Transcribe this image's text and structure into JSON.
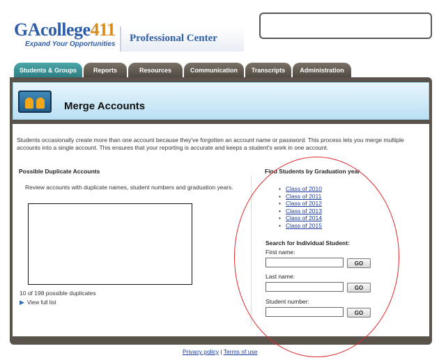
{
  "header": {
    "logo_ga": "GAcollege",
    "logo_411": "411",
    "tagline": "Expand Your Opportunities",
    "professional_center": "Professional Center"
  },
  "tabs": [
    {
      "label": "Students & Groups",
      "active": true
    },
    {
      "label": "Reports",
      "active": false
    },
    {
      "label": "Resources",
      "active": false
    },
    {
      "label": "Communication",
      "active": false
    },
    {
      "label": "Transcripts",
      "active": false
    },
    {
      "label": "Administration",
      "active": false
    }
  ],
  "page": {
    "title": "Merge Accounts",
    "intro": "Students occasionally create more than one account because they've forgotten an account name or password. This process lets you merge multiple accounts into a single account. This ensures that your reporting is accurate and keeps a student's work in one account."
  },
  "duplicates": {
    "heading": "Possible Duplicate Accounts",
    "description": "Review accounts with duplicate names, student numbers and graduation years.",
    "count_text": "10 of 198 possible duplicates",
    "view_full": "View full list"
  },
  "find": {
    "heading": "Find Students by Graduation year",
    "classes": [
      "Class of 2010",
      "Class of 2011",
      "Class of 2012",
      "Class of 2013",
      "Class of 2014",
      "Class of 2015"
    ],
    "search_heading": "Search for Individual Student:",
    "fields": [
      {
        "label": "First name:",
        "value": "",
        "button": "GO"
      },
      {
        "label": "Last name:",
        "value": "",
        "button": "GO"
      },
      {
        "label": "Student number:",
        "value": "",
        "button": "GO"
      }
    ]
  },
  "footer": {
    "privacy": "Privacy policy",
    "separator": "|",
    "terms": "Terms of use"
  },
  "colors": {
    "brand_blue": "#2f5ea8",
    "brand_orange": "#d98b1a",
    "active_tab": "#2d7c82",
    "frame": "#59534b",
    "annotation_oval": "#e0262a"
  }
}
